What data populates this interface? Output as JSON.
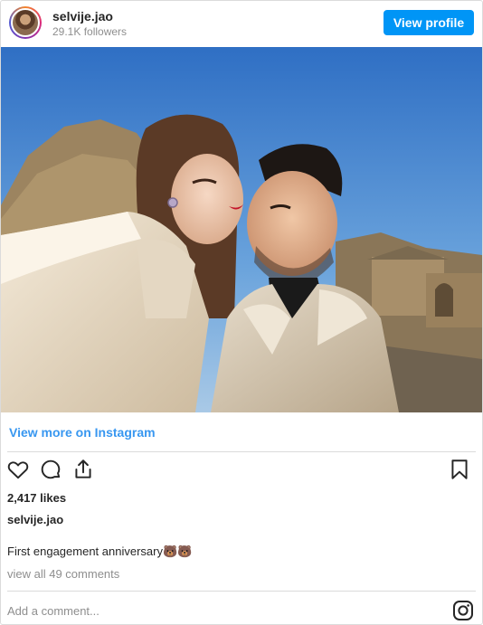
{
  "header": {
    "username": "selvije.jao",
    "followers": "29.1K followers",
    "view_profile_label": "View profile"
  },
  "post": {
    "view_more_label": "View more on Instagram",
    "likes": "2,417 likes",
    "caption_username": "selvije.jao",
    "caption_text": "First engagement anniversary🐻🐻",
    "view_all_comments": "view all 49 comments",
    "comment_placeholder": "Add a comment..."
  },
  "icons": {
    "like": "heart-icon",
    "comment": "comment-icon",
    "share": "share-icon",
    "save": "bookmark-icon",
    "brand": "instagram-logo-icon"
  },
  "colors": {
    "accent": "#0095f6",
    "link": "#3897f0",
    "muted": "#8e8e8e",
    "text": "#262626"
  }
}
